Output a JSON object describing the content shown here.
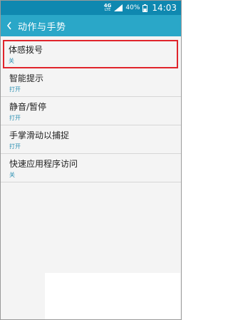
{
  "status_bar": {
    "network": "4G",
    "network_sub": "LTE",
    "battery": "40%",
    "time": "14:03"
  },
  "action_bar": {
    "title": "动作与手势"
  },
  "settings": [
    {
      "label": "体感拨号",
      "value": "关"
    },
    {
      "label": "智能提示",
      "value": "打开"
    },
    {
      "label": "静音/暂停",
      "value": "打开"
    },
    {
      "label": "手掌滑动以捕捉",
      "value": "打开"
    },
    {
      "label": "快速应用程序访问",
      "value": "关"
    }
  ],
  "colors": {
    "status_bar": "#0f88b0",
    "action_bar": "#2aa7c8",
    "value_text": "#2a8fb2",
    "highlight_border": "#e0242b"
  }
}
